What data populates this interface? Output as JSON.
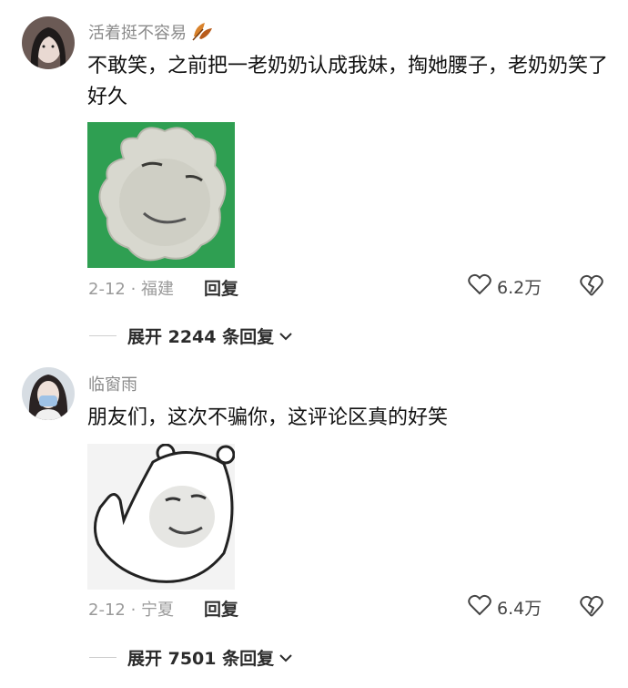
{
  "comments": [
    {
      "username": "活着挺不容易",
      "badge_icon": "autumn-leaf-icon",
      "text": "不敢笑，之前把一老奶奶认成我妹，掏她腰子，老奶奶笑了好久",
      "meta": "2-12 · 福建",
      "reply_label": "回复",
      "likes": "6.2万",
      "expand_label": "展开 2244 条回复",
      "sticker_bg": "#2f9f52"
    },
    {
      "username": "临窗雨",
      "text": "朋友们，这次不骗你，这评论区真的好笑",
      "meta": "2-12 · 宁夏",
      "reply_label": "回复",
      "likes": "6.4万",
      "expand_label": "展开 7501 条回复",
      "sticker_bg": "#f3f3f3"
    }
  ]
}
